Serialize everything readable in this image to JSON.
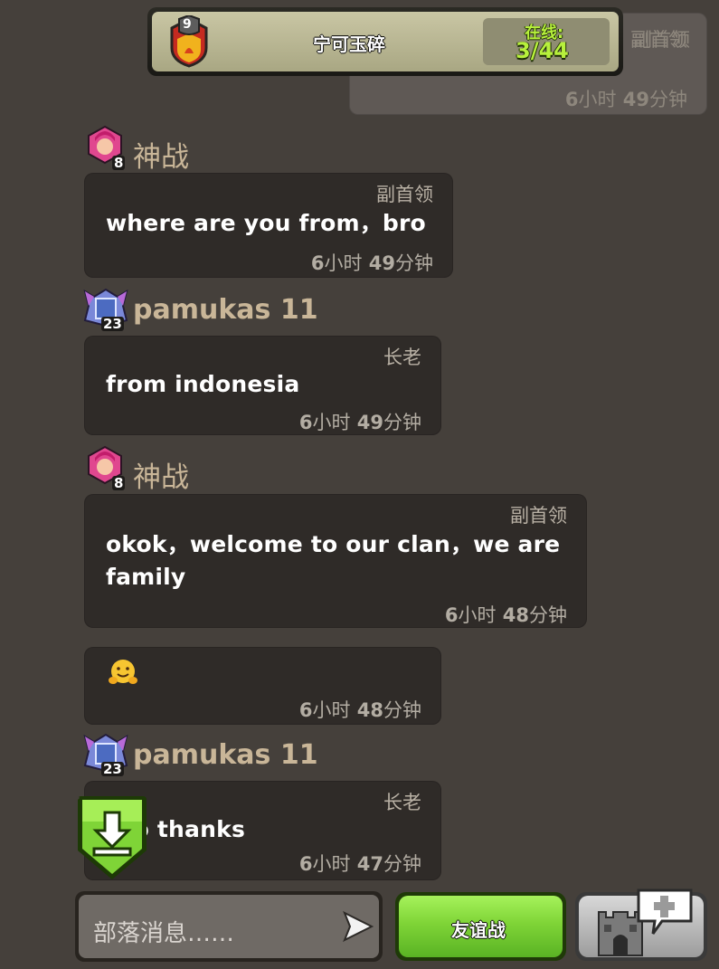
{
  "header": {
    "clan_level": "9",
    "clan_name": "宁可玉碎",
    "online_label": "在线:",
    "online_count": "3/44",
    "accent_green": "#b7f03c"
  },
  "top_bubble": {
    "role": "副首领",
    "time_num1": "6",
    "time_unit1": "小时",
    "time_num2": "49",
    "time_unit2": "分钟"
  },
  "messages": [
    {
      "sender": "神战",
      "level": "8",
      "role": "副首领",
      "lines": [
        "where are you from，bro"
      ],
      "time": [
        "6",
        "小时",
        "49",
        "分钟"
      ]
    },
    {
      "sender": "pamukas 11",
      "level": "23",
      "role": "长老",
      "lines": [
        "from indonesia"
      ],
      "time": [
        "6",
        "小时",
        "49",
        "分钟"
      ]
    },
    {
      "sender": "神战",
      "level": "8",
      "role": "副首领",
      "lines": [
        "okok，welcome to our clan，we are",
        "family"
      ],
      "time": [
        "6",
        "小时",
        "48",
        "分钟"
      ]
    },
    {
      "sender": "",
      "level": "",
      "role": "",
      "lines": [
        "🤗"
      ],
      "time": [
        "6",
        "小时",
        "48",
        "分钟"
      ]
    },
    {
      "sender": "pamukas 11",
      "level": "23",
      "role": "长老",
      "lines": [
        "bro thanks"
      ],
      "time": [
        "6",
        "小时",
        "47",
        "分钟"
      ]
    }
  ],
  "footer": {
    "input_placeholder": "部落消息……",
    "friendly_battle_label": "友谊战"
  },
  "icons": {
    "download": "download-icon",
    "send": "send-icon",
    "castle": "clan-castle-icon",
    "request": "request-plus-icon"
  }
}
